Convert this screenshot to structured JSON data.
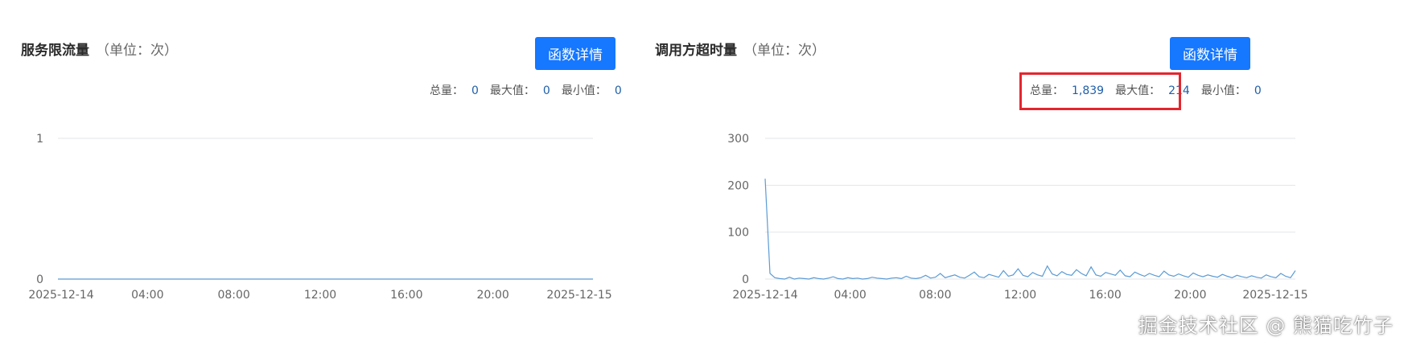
{
  "colors": {
    "accent": "#1677ff",
    "line": "#5b9bd5",
    "highlight": "#e3262f"
  },
  "panels": [
    {
      "title": "服务限流量",
      "unit": "（单位：次）",
      "button": "函数详情",
      "stats": {
        "total_label": "总量：",
        "total": "0",
        "max_label": "最大值：",
        "max": "0",
        "min_label": "最小值：",
        "min": "0"
      },
      "chart_data": {
        "type": "line",
        "ylim": [
          0,
          1
        ],
        "yticks": [
          "0",
          "1"
        ],
        "xticks": [
          "2025-12-14",
          "04:00",
          "08:00",
          "12:00",
          "16:00",
          "20:00",
          "2025-12-15"
        ],
        "series_values": [
          0,
          0,
          0,
          0,
          0,
          0,
          0
        ]
      }
    },
    {
      "title": "调用方超时量",
      "unit": "（单位：次）",
      "button": "函数详情",
      "stats": {
        "total_label": "总量：",
        "total": "1,839",
        "max_label": "最大值：",
        "max": "214",
        "min_label": "最小值：",
        "min": "0"
      },
      "chart_data": {
        "type": "line",
        "ylim": [
          0,
          300
        ],
        "yticks": [
          "0",
          "100",
          "200",
          "300"
        ],
        "xticks": [
          "2025-12-14",
          "04:00",
          "08:00",
          "12:00",
          "16:00",
          "20:00",
          "2025-12-15"
        ],
        "series_values": [
          214,
          12,
          3,
          1,
          0,
          4,
          0,
          2,
          1,
          0,
          3,
          1,
          0,
          2,
          5,
          1,
          0,
          3,
          1,
          2,
          0,
          1,
          4,
          2,
          1,
          0,
          2,
          3,
          1,
          6,
          2,
          1,
          3,
          8,
          2,
          4,
          12,
          3,
          6,
          9,
          4,
          2,
          8,
          15,
          5,
          3,
          10,
          7,
          4,
          18,
          6,
          9,
          22,
          8,
          5,
          14,
          9,
          6,
          28,
          11,
          7,
          16,
          10,
          8,
          20,
          12,
          7,
          26,
          9,
          6,
          14,
          11,
          8,
          19,
          7,
          5,
          15,
          10,
          6,
          12,
          8,
          5,
          17,
          9,
          6,
          11,
          7,
          4,
          13,
          8,
          5,
          9,
          6,
          4,
          10,
          6,
          3,
          8,
          5,
          3,
          7,
          4,
          2,
          9,
          5,
          3,
          12,
          6,
          3,
          18
        ]
      }
    }
  ],
  "watermark": "掘金技术社区 @ 熊猫吃竹子"
}
